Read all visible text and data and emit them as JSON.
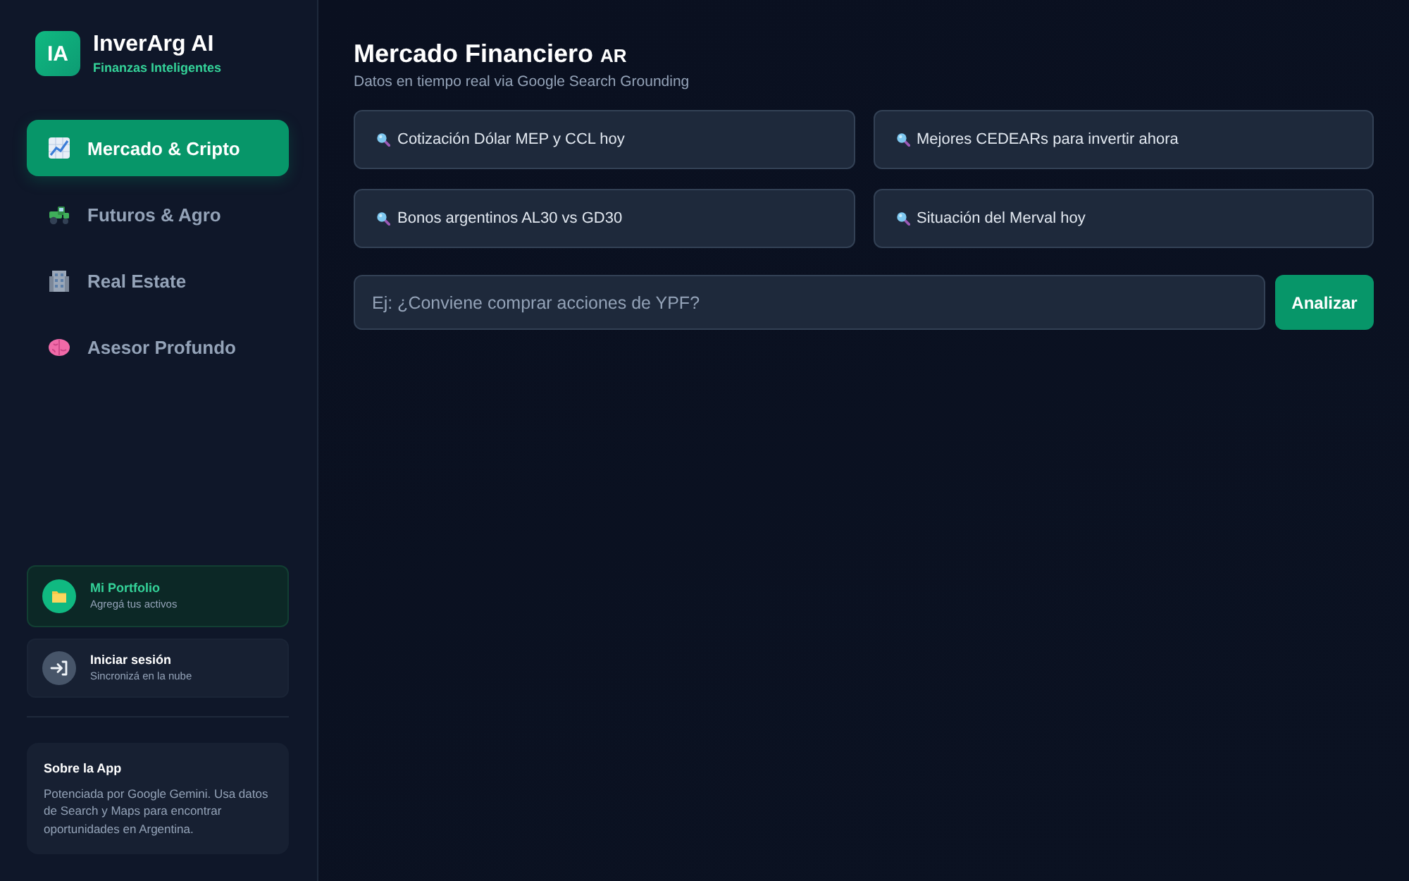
{
  "brand": {
    "logo": "IA",
    "name": "InverArg AI",
    "tagline": "Finanzas Inteligentes"
  },
  "nav": [
    {
      "label": "Mercado & Cripto",
      "selected": true
    },
    {
      "label": "Futuros & Agro",
      "selected": false
    },
    {
      "label": "Real Estate",
      "selected": false
    },
    {
      "label": "Asesor Profundo",
      "selected": false
    }
  ],
  "account": [
    {
      "kind": "portfolio",
      "title": "Mi Portfolio",
      "subtitle": "Agregá tus activos"
    },
    {
      "kind": "login",
      "title": "Iniciar sesión",
      "subtitle": "Sincronizá en la nube"
    }
  ],
  "about": {
    "title": "Sobre la App",
    "text": "Potenciada por Google Gemini. Usa datos de Search y Maps para encontrar oportunidades en Argentina."
  },
  "page": {
    "title": "Mercado Financiero",
    "badge": "AR",
    "subtitle": "Datos en tiempo real via Google Search Grounding"
  },
  "suggestions": [
    "Cotización Dólar MEP y CCL hoy",
    "Mejores CEDEARs para invertir ahora",
    "Bonos argentinos AL30 vs GD30",
    "Situación del Merval hoy"
  ],
  "query": {
    "placeholder": "Ej: ¿Conviene comprar acciones de YPF?",
    "button": "Analizar"
  }
}
